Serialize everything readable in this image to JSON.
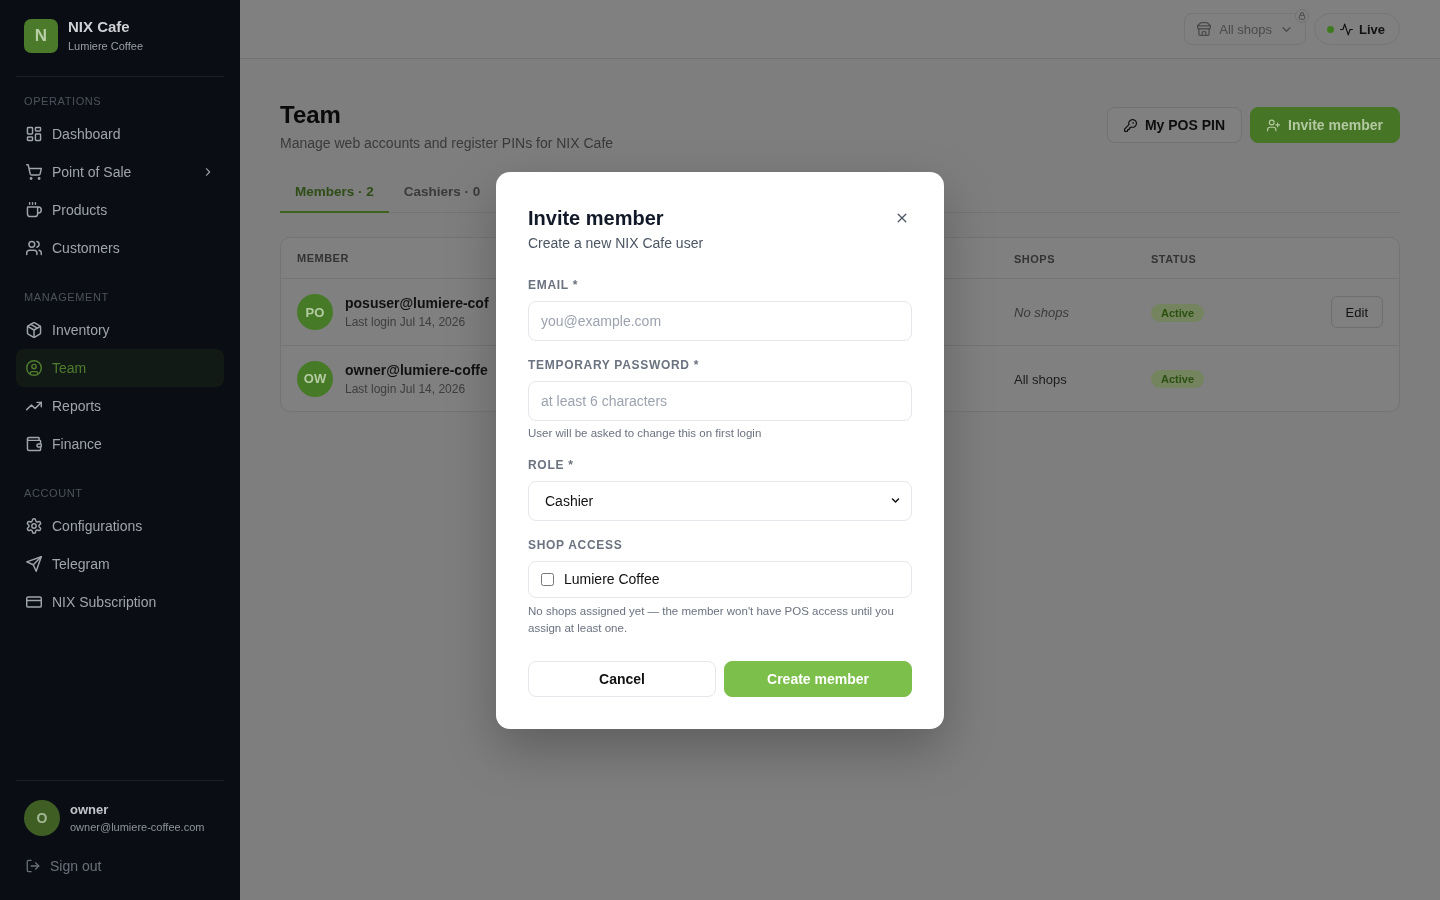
{
  "sidebar": {
    "brand": {
      "logo": "N",
      "name": "NIX Cafe",
      "subtitle": "Lumiere Coffee"
    },
    "sections": [
      {
        "title": "OPERATIONS",
        "items": [
          {
            "label": "Dashboard",
            "selected": false,
            "expandable": false
          },
          {
            "label": "Point of Sale",
            "selected": false,
            "expandable": true
          },
          {
            "label": "Products",
            "selected": false,
            "expandable": false
          },
          {
            "label": "Customers",
            "selected": false,
            "expandable": false
          }
        ]
      },
      {
        "title": "MANAGEMENT",
        "items": [
          {
            "label": "Inventory",
            "selected": false,
            "expandable": false
          },
          {
            "label": "Team",
            "selected": true,
            "expandable": false
          },
          {
            "label": "Reports",
            "selected": false,
            "expandable": false
          },
          {
            "label": "Finance",
            "selected": false,
            "expandable": false
          }
        ]
      },
      {
        "title": "ACCOUNT",
        "items": [
          {
            "label": "Configurations",
            "selected": false,
            "expandable": false
          },
          {
            "label": "Telegram",
            "selected": false,
            "expandable": false
          },
          {
            "label": "NIX Subscription",
            "selected": false,
            "expandable": false
          }
        ]
      }
    ],
    "user": {
      "initial": "O",
      "name": "owner",
      "email": "owner@lumiere-coffee.com"
    },
    "sign_out": "Sign out"
  },
  "top_bar": {
    "shop_selector": {
      "label": "All shops",
      "locked": true
    },
    "live": {
      "label": "Live",
      "on": true
    }
  },
  "page": {
    "title": "Team",
    "subtitle": "Manage web accounts and register PINs for NIX Cafe",
    "actions": [
      {
        "label": "My POS PIN",
        "kind": "secondary"
      },
      {
        "label": "Invite member",
        "kind": "primary"
      }
    ]
  },
  "tabs": [
    {
      "label": "Members · 2",
      "selected": true
    },
    {
      "label": "Cashiers · 0",
      "selected": false
    }
  ],
  "table": {
    "columns": [
      "MEMBER",
      "SHOPS",
      "STATUS"
    ],
    "rows": [
      {
        "initials": "PO",
        "email": "posuser@lumiere-cof",
        "last_login": "Last login Jul 14, 2026",
        "shops": "No shops",
        "shops_assigned": false,
        "status": "Active",
        "action": "Edit"
      },
      {
        "initials": "OW",
        "email": "owner@lumiere-coffe",
        "last_login": "Last login Jul 14, 2026",
        "shops": "All shops",
        "shops_assigned": true,
        "status": "Active"
      }
    ]
  },
  "modal": {
    "title": "Invite member",
    "subtitle": "Create a new NIX Cafe user",
    "fields": [
      {
        "kind": "text",
        "label": "EMAIL *",
        "placeholder": "you@example.com"
      },
      {
        "kind": "password",
        "label": "TEMPORARY PASSWORD *",
        "placeholder": "at least 6 characters",
        "hint": "User will be asked to change this on first login"
      },
      {
        "kind": "select",
        "label": "ROLE *",
        "value": "Cashier"
      },
      {
        "kind": "checklist",
        "label": "SHOP ACCESS",
        "options": [
          {
            "label": "Lumiere Coffee",
            "checked": false
          }
        ],
        "hint": "No shops assigned yet — the member won't have POS access until you assign at least one."
      }
    ],
    "buttons": [
      {
        "label": "Cancel",
        "kind": "secondary"
      },
      {
        "label": "Create member",
        "kind": "primary"
      }
    ]
  }
}
